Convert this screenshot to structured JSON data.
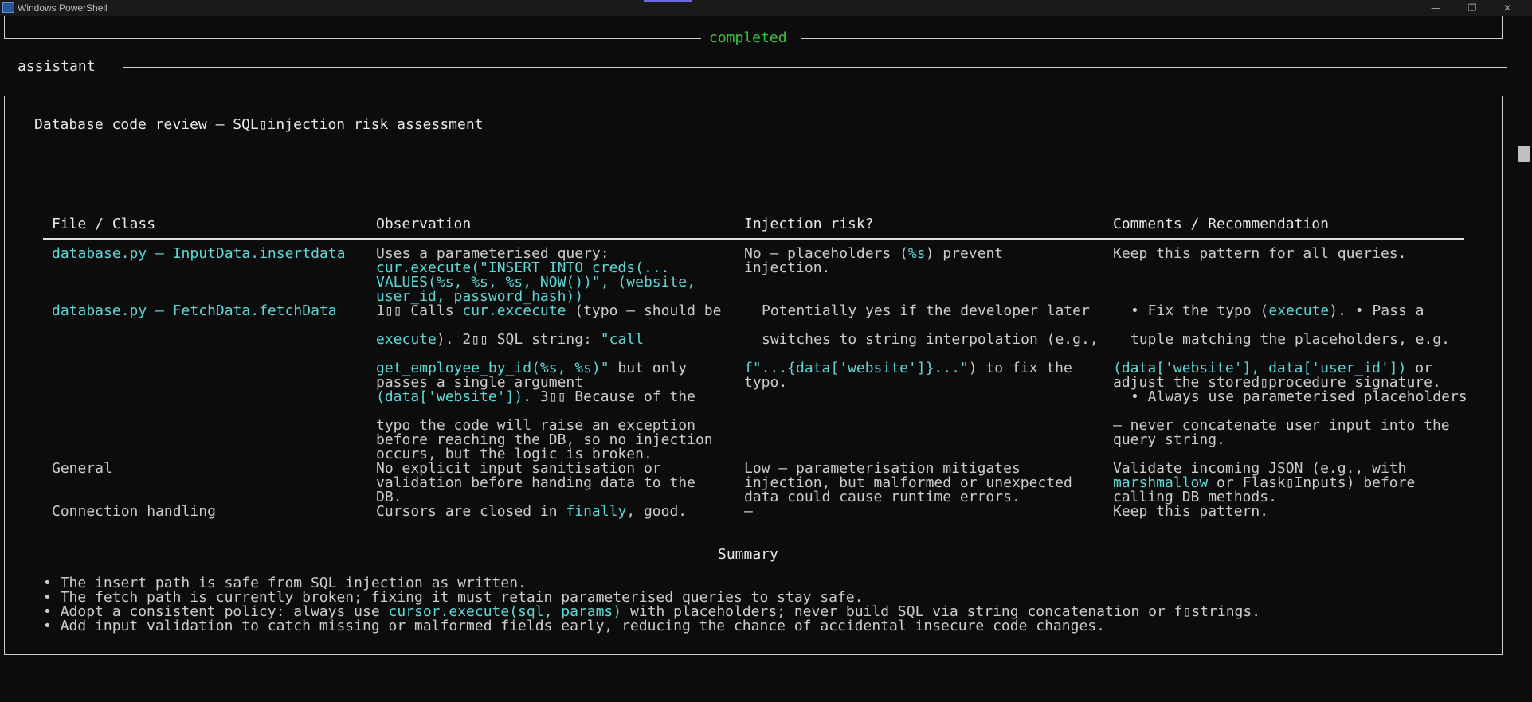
{
  "window": {
    "title": "Windows PowerShell"
  },
  "status": {
    "completed_label": "completed"
  },
  "assistant_label": "assistant",
  "review_title": "Database code review – SQL▯injection risk assessment",
  "table": {
    "headers": [
      "File / Class",
      "Observation",
      "Injection risk?",
      "Comments / Recommendation"
    ],
    "rows": [
      {
        "file": "database.py – InputData.insertdata",
        "observation": [
          "Uses a parameterised query:",
          "cur.execute(\"INSERT INTO creds(...",
          "VALUES(%s, %s, %s, NOW())\", (website,",
          "user_id, password_hash))"
        ],
        "risk_a": "No – placeholders (",
        "risk_code": "%s",
        "risk_b": ") prevent",
        "risk_c": "injection.",
        "comment": "Keep this pattern for all queries."
      },
      {
        "file": "database.py – FetchData.fetchData",
        "obs_1a": "1▯▯ Calls ",
        "obs_1b": "cur.excecute",
        "obs_1c": " (typo – should be",
        "obs_2a": "execute",
        "obs_2b": "). 2▯▯ SQL string: ",
        "obs_2c": "\"call",
        "obs_3a": "get_employee_by_id(%s, %s)\"",
        "obs_3b": " but only",
        "obs_4": "passes a single argument",
        "obs_5a": "(data['website'])",
        "obs_5b": ". 3▯▯ Because of the",
        "obs_6": "typo the code will raise an exception",
        "obs_7": "before reaching the DB, so no injection",
        "obs_8": "occurs, but the logic is broken.",
        "risk_1": "Potentially yes if the developer later",
        "risk_2": "switches to string interpolation (e.g.,",
        "risk_3a": "f\"...{data['website']}...\"",
        "risk_3b": ") to fix the",
        "risk_4": "typo.",
        "com_1a": "• Fix the typo (",
        "com_1b": "execute",
        "com_1c": "). • Pass a",
        "com_2": "tuple matching the placeholders, e.g.",
        "com_3a": "(data['website'], data['user_id'])",
        "com_3b": " or",
        "com_4": "adjust the stored▯procedure signature.",
        "com_5": "• Always use parameterised placeholders",
        "com_6": "– never concatenate user input into the",
        "com_7": "query string."
      },
      {
        "file": "General",
        "observation": [
          "No explicit input sanitisation or",
          "validation before handing data to the",
          "DB."
        ],
        "risk": [
          "Low – parameterisation mitigates",
          "injection, but malformed or unexpected",
          "data could cause runtime errors."
        ],
        "com_1": "Validate incoming JSON (e.g., with",
        "com_2a": "marshmallow",
        "com_2b": " or Flask▯Inputs) before",
        "com_3": "calling DB methods."
      },
      {
        "file": "Connection handling",
        "obs_a": "Cursors are closed in ",
        "obs_b": "finally",
        "obs_c": ", good.",
        "risk": "–",
        "comment": "Keep this pattern."
      }
    ]
  },
  "summary": {
    "heading": "Summary",
    "bullet": "•",
    "items": [
      "The insert path is safe from SQL injection as written.",
      "The fetch path is currently broken; fixing it must retain parameterised queries to stay safe."
    ],
    "item3_a": "Adopt a consistent policy: always use ",
    "item3_code": "cursor.execute(sql, params)",
    "item3_b": " with placeholders; never build SQL via string concatenation or f▯strings.",
    "item4": "Add input validation to catch missing or malformed fields early, reducing the chance of accidental insecure code changes."
  },
  "colors": {
    "background": "#0c0c0c",
    "text": "#cccccc",
    "code": "#5fd7d7",
    "completed": "#3cc23c"
  }
}
